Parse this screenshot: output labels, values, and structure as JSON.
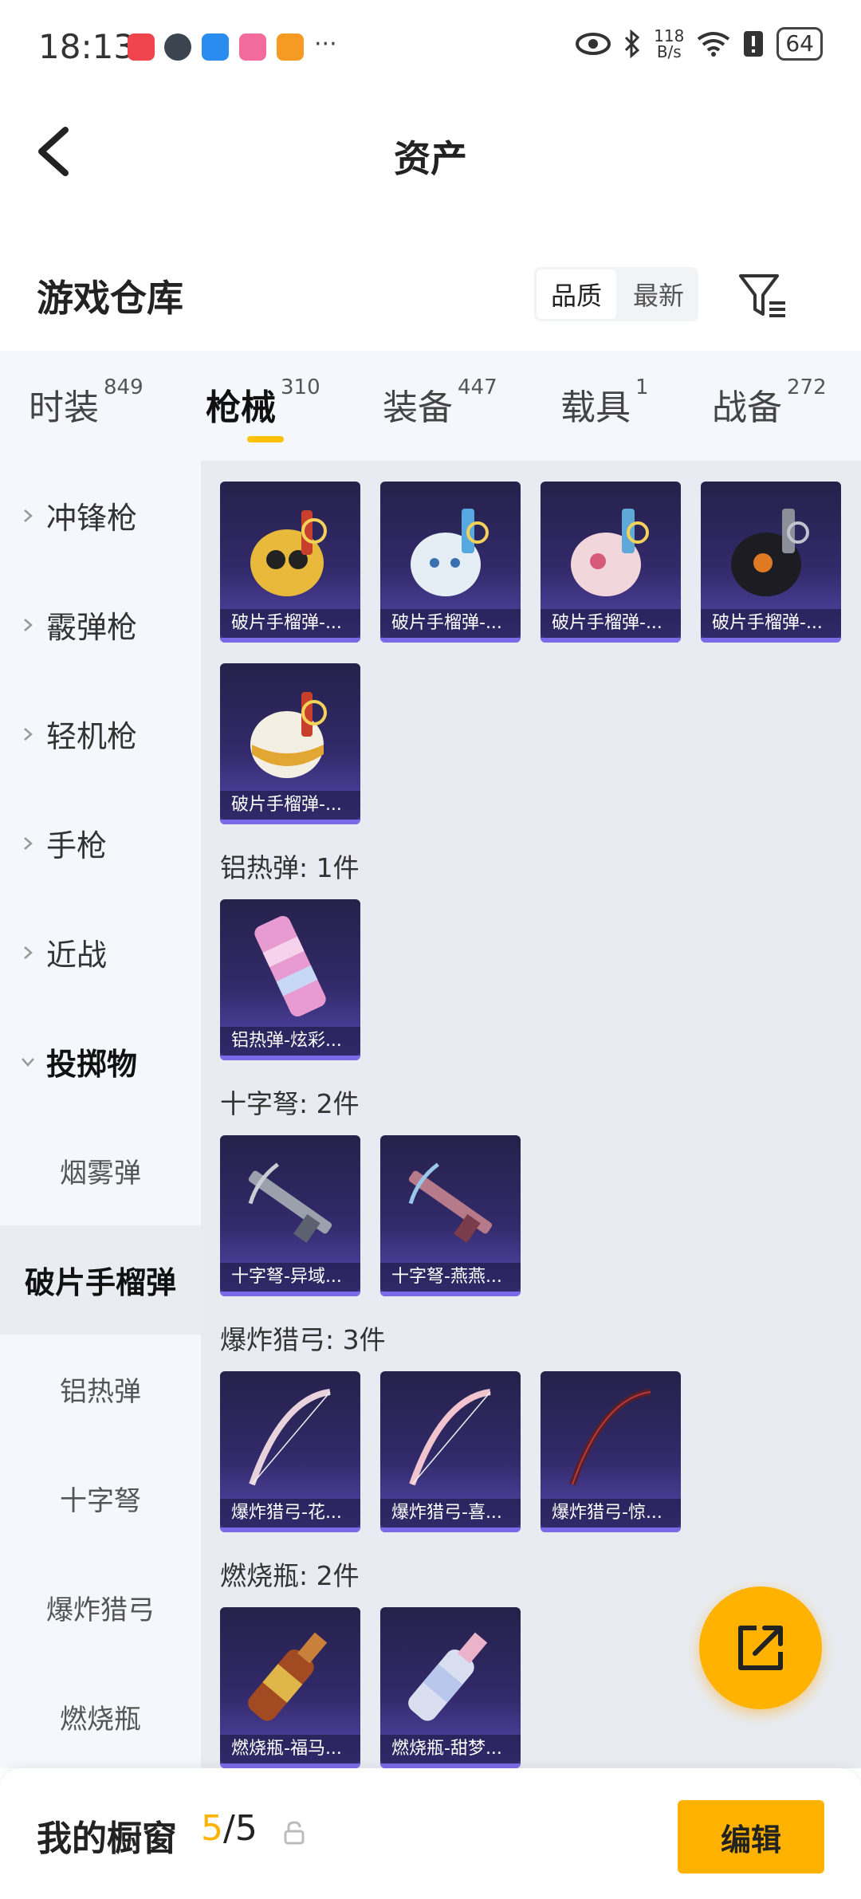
{
  "status_bar": {
    "time": "18:13",
    "more": "···",
    "net_speed_value": "118",
    "net_speed_unit": "B/s",
    "battery": "64"
  },
  "app_bar": {
    "title": "资产"
  },
  "warehouse": {
    "title": "游戏仓库",
    "sort_options": [
      "品质",
      "最新"
    ],
    "active_sort": "品质"
  },
  "tabs": [
    {
      "label": "时装",
      "count": "849"
    },
    {
      "label": "枪械",
      "count": "310",
      "active": true
    },
    {
      "label": "装备",
      "count": "447"
    },
    {
      "label": "载具",
      "count": "1"
    },
    {
      "label": "战备",
      "count": "272"
    }
  ],
  "sidebar": {
    "categories": [
      "冲锋枪",
      "霰弹枪",
      "轻机枪",
      "手枪",
      "近战",
      "投掷物"
    ],
    "subcategories": [
      "烟雾弹",
      "破片手榴弹",
      "铝热弹",
      "十字弩",
      "爆炸猎弓",
      "燃烧瓶"
    ],
    "active_subcategory": "破片手榴弹"
  },
  "groups": [
    {
      "title": "",
      "items": [
        "破片手榴弹-...",
        "破片手榴弹-...",
        "破片手榴弹-...",
        "破片手榴弹-...",
        "破片手榴弹-..."
      ]
    },
    {
      "title": "铝热弹: 1件",
      "items": [
        "铝热弹-炫彩..."
      ]
    },
    {
      "title": "十字弩: 2件",
      "items": [
        "十字弩-异域...",
        "十字弩-燕燕..."
      ]
    },
    {
      "title": "爆炸猎弓: 3件",
      "items": [
        "爆炸猎弓-花...",
        "爆炸猎弓-喜...",
        "爆炸猎弓-惊..."
      ]
    },
    {
      "title": "燃烧瓶: 2件",
      "items": [
        "燃烧瓶-福马...",
        "燃烧瓶-甜梦..."
      ]
    }
  ],
  "bottom_bar": {
    "title": "我的橱窗",
    "count_current": "5",
    "count_total": "/5",
    "edit_label": "编辑"
  },
  "colors": {
    "accent": "#ffb300",
    "card_bg": "#322a6a",
    "content_bg": "#e8ecf2",
    "sidebar_bg": "#f4f7fb"
  }
}
